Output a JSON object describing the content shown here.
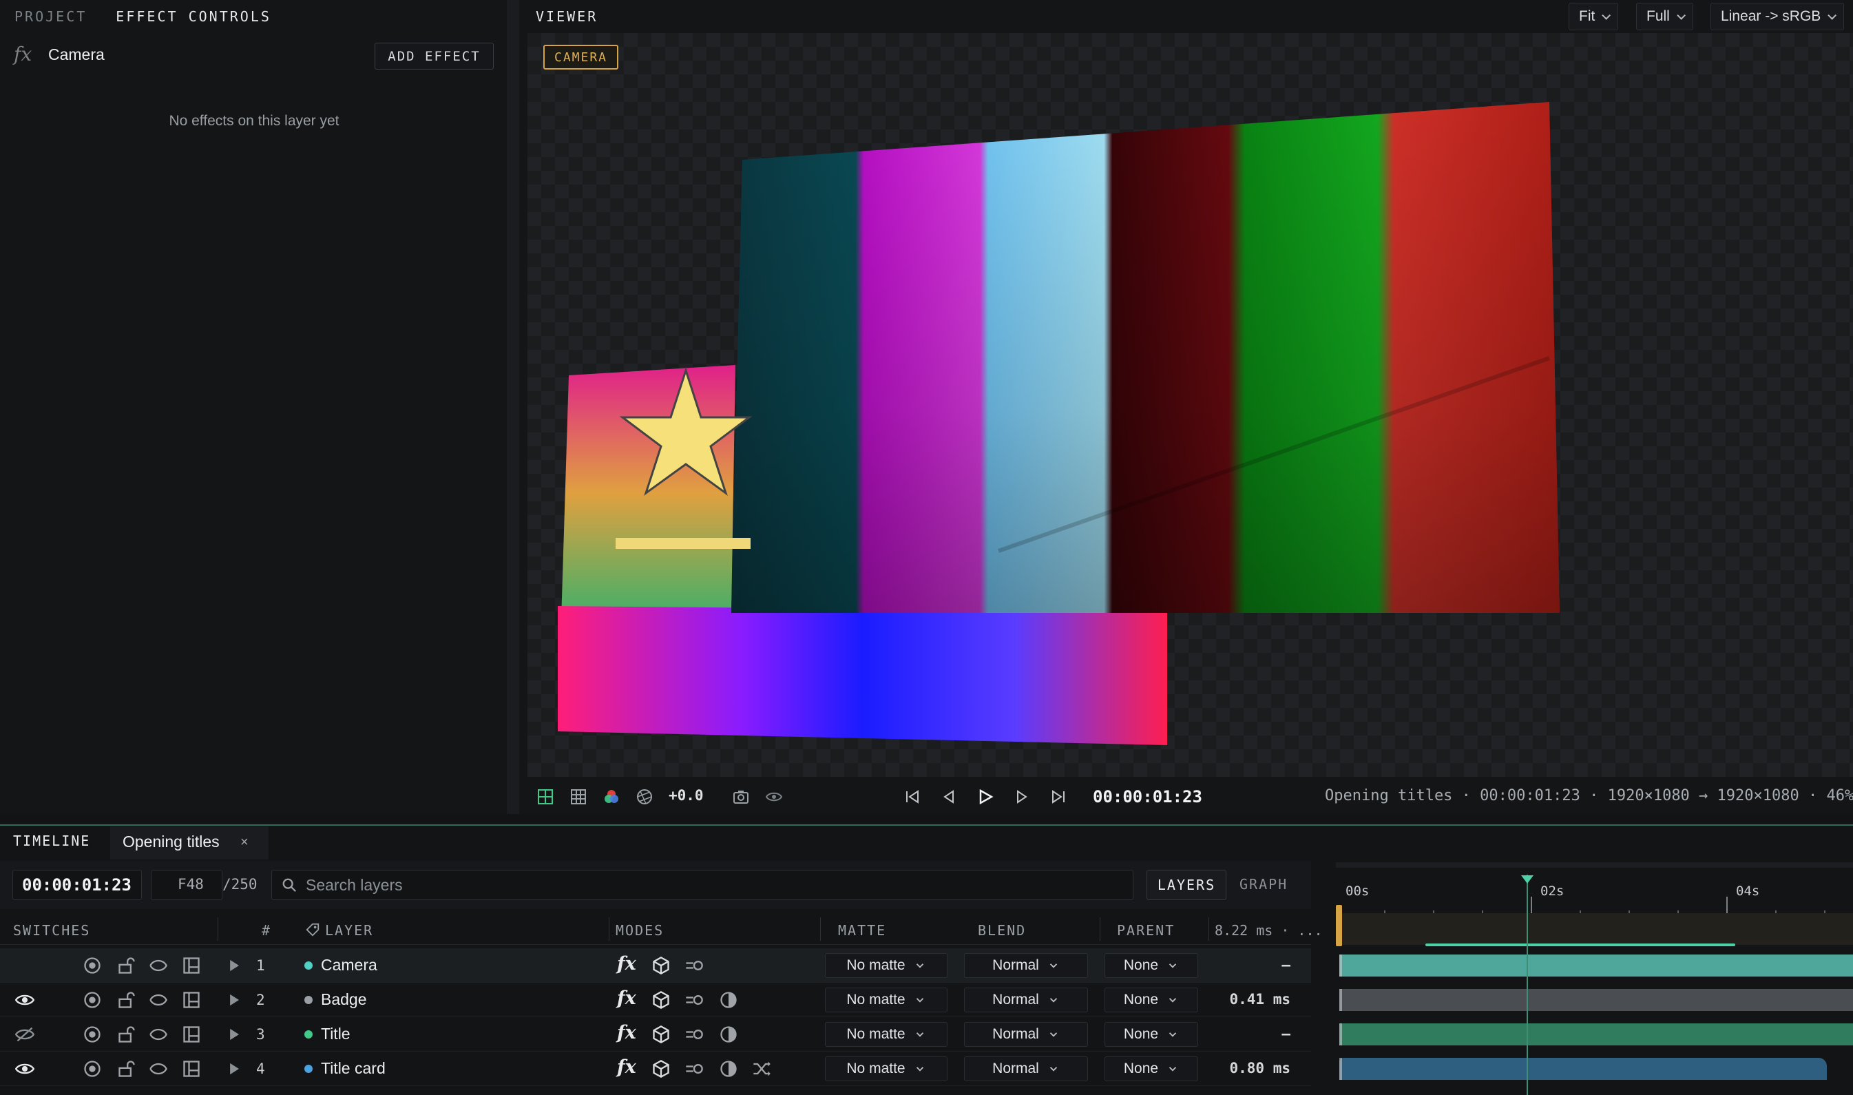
{
  "left_panel": {
    "tabs": [
      "PROJECT",
      "EFFECT CONTROLS"
    ],
    "active_tab": "EFFECT CONTROLS",
    "fx_glyph": "fx",
    "layer_name": "Camera",
    "add_effect_label": "ADD EFFECT",
    "empty_message": "No effects on this layer yet"
  },
  "viewer": {
    "title": "VIEWER",
    "zoom_select": "Fit",
    "resolution_select": "Full",
    "color_select": "Linear -> sRGB",
    "camera_badge": "CAMERA",
    "exposure": "+0.0",
    "timecode": "00:00:01:23",
    "info": "Opening titles · 00:00:01:23 · 1920×1080 → 1920×1080 · 46%",
    "colors": {
      "badge_accent": "#d7a445",
      "star_fill": "#f6e07a"
    }
  },
  "timeline": {
    "label": "TIMELINE",
    "comp_tab": "Opening titles",
    "comp_tab_close": "×",
    "timecode": "00:00:01:23",
    "frame": "F48",
    "frame_total": "/250",
    "search_placeholder": "Search layers",
    "layers_button": "LAYERS",
    "graph_button": "GRAPH",
    "columns": {
      "switches": "SWITCHES",
      "number": "#",
      "layer": "LAYER",
      "modes": "MODES",
      "matte": "MATTE",
      "blend": "BLEND",
      "parent": "PARENT",
      "timing": "8.22 ms · ..."
    },
    "ruler_labels": [
      "00s",
      "02s",
      "04s"
    ],
    "rows": [
      {
        "num": "1",
        "name": "Camera",
        "dot_color": "#4fd1c5",
        "visibility": "none",
        "matte": "No matte",
        "blend": "Normal",
        "parent": "None",
        "time": "–",
        "track_color": "#4fa79c"
      },
      {
        "num": "2",
        "name": "Badge",
        "dot_color": "#9aa0a6",
        "visibility": "visible",
        "matte": "No matte",
        "blend": "Normal",
        "parent": "None",
        "time": "0.41 ms",
        "track_color": "#4a4d51"
      },
      {
        "num": "3",
        "name": "Title",
        "dot_color": "#41c98a",
        "visibility": "hidden",
        "matte": "No matte",
        "blend": "Normal",
        "parent": "None",
        "time": "–",
        "track_color": "#2f7d5e"
      },
      {
        "num": "4",
        "name": "Title card",
        "dot_color": "#4aa3e0",
        "visibility": "visible",
        "matte": "No matte",
        "blend": "Normal",
        "parent": "None",
        "time": "0.80 ms",
        "track_color": "#2f5f80"
      }
    ]
  }
}
